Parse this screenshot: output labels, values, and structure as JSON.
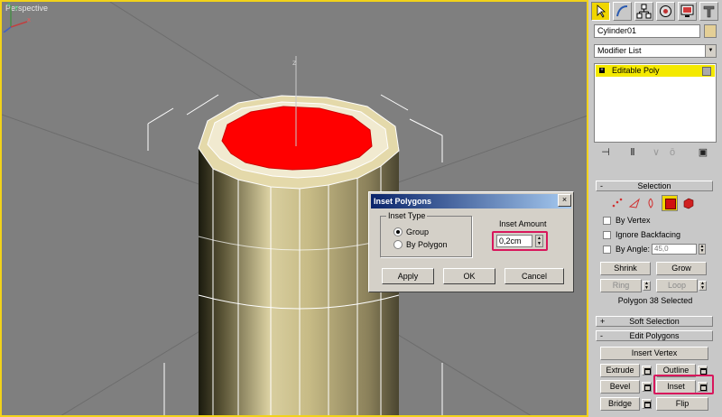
{
  "viewport": {
    "label": "Perspective"
  },
  "dialog": {
    "title": "Inset Polygons",
    "close_glyph": "×",
    "inset_type_label": "Inset Type",
    "options": [
      "Group",
      "By Polygon"
    ],
    "inset_amount_label": "Inset Amount",
    "inset_amount_value": "0,2cm",
    "buttons": {
      "apply": "Apply",
      "ok": "OK",
      "cancel": "Cancel"
    }
  },
  "panel": {
    "object_name": "Cylinder01",
    "modifier_list": "Modifier List",
    "stack_item": "Editable Poly",
    "selection": {
      "header": "Selection",
      "by_vertex": "By Vertex",
      "ignore_backfacing": "Ignore Backfacing",
      "by_angle": "By Angle:",
      "angle_value": "45,0",
      "shrink": "Shrink",
      "grow": "Grow",
      "ring": "Ring",
      "loop": "Loop",
      "status": "Polygon 38 Selected"
    },
    "soft_selection": {
      "header": "Soft Selection"
    },
    "edit_polygons": {
      "header": "Edit Polygons",
      "insert_vertex": "Insert Vertex",
      "extrude": "Extrude",
      "outline": "Outline",
      "bevel": "Bevel",
      "inset": "Inset",
      "bridge": "Bridge",
      "flip": "Flip"
    },
    "rollout_plus": "+",
    "rollout_minus": "-"
  },
  "colors": {
    "viewport_bg": "#7f7f7f",
    "highlight": "#d8175c",
    "selection_face": "#ff0000",
    "active_tool": "#f0d600"
  }
}
